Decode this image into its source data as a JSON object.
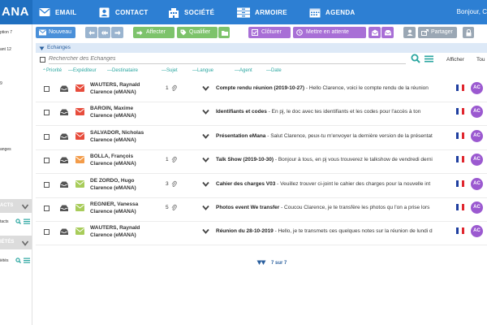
{
  "header": {
    "logo": "ANA",
    "nav": [
      {
        "label": "EMAIL",
        "icon": "email-icon"
      },
      {
        "label": "CONTACT",
        "icon": "contact-card-icon"
      },
      {
        "label": "SOCIÉTÉ",
        "icon": "building-icon"
      },
      {
        "label": "ARMOIRE",
        "icon": "cabinet-icon"
      },
      {
        "label": "AGENDA",
        "icon": "calendar-icon"
      }
    ],
    "greeting": "Bonjour, C"
  },
  "sidebar": {
    "lines": [
      "ption 7",
      "ant 12",
      "9",
      "anges"
    ],
    "sections": [
      {
        "title": "ACTS",
        "search": "tacts"
      },
      {
        "title": "IÉTÉS",
        "search": "iétés"
      }
    ]
  },
  "toolbar": {
    "new_label": "Nouveau",
    "assign_label": "Affecter",
    "qualify_label": "Qualifier",
    "close_label": "Clôturer",
    "hold_label": "Mettre en attente",
    "share_label": "Partager"
  },
  "breadcrumb": "Echanges",
  "search": {
    "placeholder": "Rechercher des Echanges",
    "show_label": "Afficher",
    "show_value": "Tou"
  },
  "columns": [
    "Priorité",
    "Expéditeur",
    "Destinataire",
    "Sujet",
    "Langue",
    "Agent",
    "Date"
  ],
  "rows": [
    {
      "name": "WAUTERS, Raynald",
      "org": "Clarence (eMANA)",
      "count": "1",
      "env": "#e74c3c",
      "subject": "Compte rendu réunion (2019-10-27)",
      "preview": " - Hello Clarence, voici le compte rendu de la réunion",
      "agent": "AC"
    },
    {
      "name": "BAROIN, Maxime",
      "org": "Clarence (eMANA)",
      "count": "",
      "env": "#e74c3c",
      "subject": "Identifiants et codes",
      "preview": " - En pj, le doc avec tes identifiants et les codes pour l'accès à ton",
      "agent": "AC"
    },
    {
      "name": "SALVADOR, Nicholas",
      "org": "Clarence (eMANA)",
      "count": "",
      "env": "#e74c3c",
      "subject": "Présentation eMana",
      "preview": " - Salut Clarence, peux-tu m'envoyer la dernière version de la présentat",
      "agent": "AC"
    },
    {
      "name": "BOLLA, François",
      "org": "Clarence (eMANA)",
      "count": "1",
      "env": "#f39c4a",
      "subject": "Talk Show (2019-10-30)",
      "preview": " - Bonjour à tous, en pj vous trouverez le talkshow de vendredi derni",
      "agent": "AC"
    },
    {
      "name": "DE ZORDO, Hugo",
      "org": "Clarence (eMANA)",
      "count": "3",
      "env": "#a8cc5a",
      "subject": "Cahier des charges V03",
      "preview": " - Veuillez trouver ci-joint le cahier des charges pour la nouvelle int",
      "agent": "AC"
    },
    {
      "name": "REGNIER, Vanessa",
      "org": "Clarence (eMANA)",
      "count": "5",
      "env": "#a8cc5a",
      "subject": "Photos event We transfer",
      "preview": " - Coucou Clarence, je te transfère les photos qu l'on a prise lors",
      "agent": "AC"
    },
    {
      "name": "WAUTERS, Raynald",
      "org": "Clarence (eMANA)",
      "count": "",
      "env": "#a8cc5a",
      "subject": "Réunion du 28-10-2019",
      "preview": " - Hello, je te transmets ces quelques notes sur la réunion de lundi d",
      "agent": "AC"
    }
  ],
  "pager": "7 sur 7",
  "colors": {
    "topbar": "#2d7fd3",
    "toolbar_blue": "#4a90d9",
    "toolbar_green": "#7dc36b",
    "toolbar_purple": "#a86fd6",
    "toolbar_gray": "#9aa7b4",
    "teal": "#2aa6a0",
    "avatar": "#9b59d0"
  }
}
